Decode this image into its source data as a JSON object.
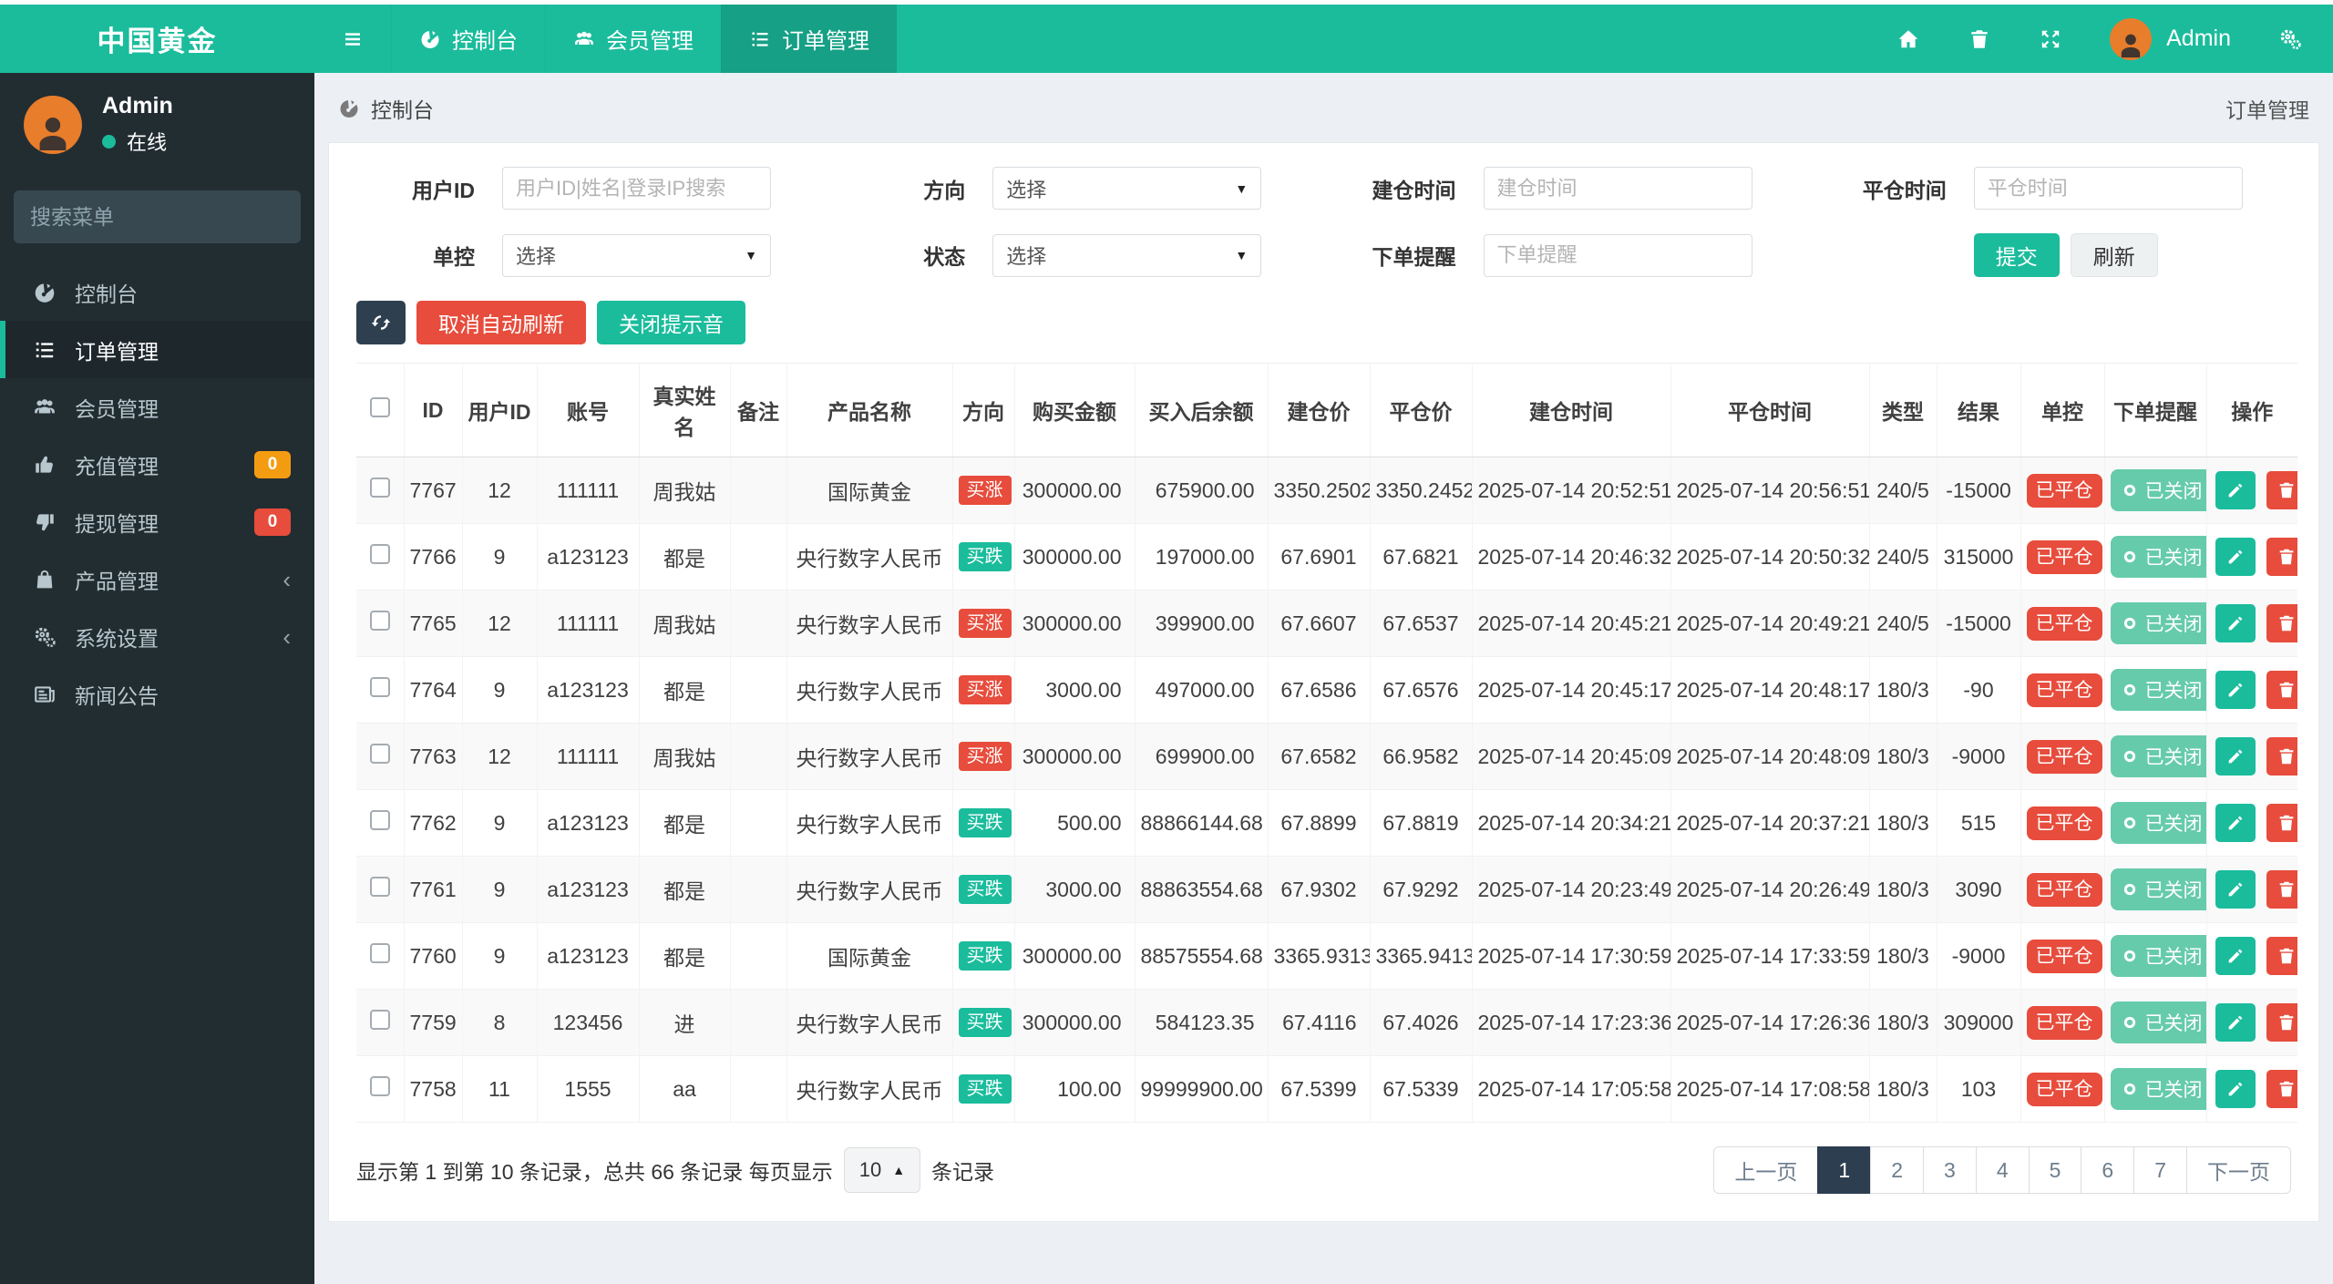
{
  "brand": {
    "title": "中国黄金"
  },
  "navbar": {
    "tabs": [
      {
        "label": "控制台"
      },
      {
        "label": "会员管理"
      },
      {
        "label": "订单管理"
      }
    ],
    "user": "Admin"
  },
  "sidebar": {
    "user": {
      "name": "Admin",
      "status": "在线"
    },
    "search_placeholder": "搜索菜单",
    "items": [
      {
        "label": "控制台"
      },
      {
        "label": "订单管理"
      },
      {
        "label": "会员管理"
      },
      {
        "label": "充值管理",
        "badge": "0",
        "badge_color": "#f39c12"
      },
      {
        "label": "提现管理",
        "badge": "0",
        "badge_color": "#e74c3c"
      },
      {
        "label": "产品管理"
      },
      {
        "label": "系统设置"
      },
      {
        "label": "新闻公告"
      }
    ]
  },
  "breadcrumb": {
    "label": "控制台"
  },
  "page_title": "订单管理",
  "filters": {
    "user_id": {
      "label": "用户ID",
      "placeholder": "用户ID|姓名|登录IP搜索",
      "value": ""
    },
    "direction": {
      "label": "方向",
      "value": "选择"
    },
    "open_time": {
      "label": "建仓时间",
      "placeholder": "建仓时间",
      "value": ""
    },
    "close_time": {
      "label": "平仓时间",
      "placeholder": "平仓时间",
      "value": ""
    },
    "control": {
      "label": "单控",
      "value": "选择"
    },
    "status": {
      "label": "状态",
      "value": "选择"
    },
    "reminder": {
      "label": "下单提醒",
      "placeholder": "下单提醒",
      "value": ""
    },
    "submit": "提交",
    "refresh": "刷新"
  },
  "toolbar": {
    "cancel_auto_refresh": "取消自动刷新",
    "mute": "关闭提示音"
  },
  "table": {
    "headers": [
      "ID",
      "用户ID",
      "账号",
      "真实姓名",
      "备注",
      "产品名称",
      "方向",
      "购买金额",
      "买入后余额",
      "建仓价",
      "平仓价",
      "建仓时间",
      "平仓时间",
      "类型",
      "结果",
      "单控",
      "下单提醒",
      "操作"
    ],
    "direction_colors": {
      "买涨": "#e74c3c",
      "买跌": "#1abc9c"
    },
    "rows": [
      {
        "id": "7767",
        "uid": "12",
        "account": "111111",
        "name": "周我姑",
        "remark": "",
        "product": "国际黄金",
        "dir": "买涨",
        "amount": "300000.00",
        "balance": "675900.00",
        "open_price": "3350.2502",
        "close_price": "3350.2452",
        "open_time": "2025-07-14 20:52:51",
        "close_time": "2025-07-14 20:56:51",
        "type": "240/5",
        "result": "-15000",
        "control": "已平仓",
        "reminder": "已关闭"
      },
      {
        "id": "7766",
        "uid": "9",
        "account": "a123123",
        "name": "都是",
        "remark": "",
        "product": "央行数字人民币",
        "dir": "买跌",
        "amount": "300000.00",
        "balance": "197000.00",
        "open_price": "67.6901",
        "close_price": "67.6821",
        "open_time": "2025-07-14 20:46:32",
        "close_time": "2025-07-14 20:50:32",
        "type": "240/5",
        "result": "315000",
        "control": "已平仓",
        "reminder": "已关闭"
      },
      {
        "id": "7765",
        "uid": "12",
        "account": "111111",
        "name": "周我姑",
        "remark": "",
        "product": "央行数字人民币",
        "dir": "买涨",
        "amount": "300000.00",
        "balance": "399900.00",
        "open_price": "67.6607",
        "close_price": "67.6537",
        "open_time": "2025-07-14 20:45:21",
        "close_time": "2025-07-14 20:49:21",
        "type": "240/5",
        "result": "-15000",
        "control": "已平仓",
        "reminder": "已关闭"
      },
      {
        "id": "7764",
        "uid": "9",
        "account": "a123123",
        "name": "都是",
        "remark": "",
        "product": "央行数字人民币",
        "dir": "买涨",
        "amount": "3000.00",
        "balance": "497000.00",
        "open_price": "67.6586",
        "close_price": "67.6576",
        "open_time": "2025-07-14 20:45:17",
        "close_time": "2025-07-14 20:48:17",
        "type": "180/3",
        "result": "-90",
        "control": "已平仓",
        "reminder": "已关闭"
      },
      {
        "id": "7763",
        "uid": "12",
        "account": "111111",
        "name": "周我姑",
        "remark": "",
        "product": "央行数字人民币",
        "dir": "买涨",
        "amount": "300000.00",
        "balance": "699900.00",
        "open_price": "67.6582",
        "close_price": "66.9582",
        "open_time": "2025-07-14 20:45:09",
        "close_time": "2025-07-14 20:48:09",
        "type": "180/3",
        "result": "-9000",
        "control": "已平仓",
        "reminder": "已关闭"
      },
      {
        "id": "7762",
        "uid": "9",
        "account": "a123123",
        "name": "都是",
        "remark": "",
        "product": "央行数字人民币",
        "dir": "买跌",
        "amount": "500.00",
        "balance": "88866144.68",
        "open_price": "67.8899",
        "close_price": "67.8819",
        "open_time": "2025-07-14 20:34:21",
        "close_time": "2025-07-14 20:37:21",
        "type": "180/3",
        "result": "515",
        "control": "已平仓",
        "reminder": "已关闭"
      },
      {
        "id": "7761",
        "uid": "9",
        "account": "a123123",
        "name": "都是",
        "remark": "",
        "product": "央行数字人民币",
        "dir": "买跌",
        "amount": "3000.00",
        "balance": "88863554.68",
        "open_price": "67.9302",
        "close_price": "67.9292",
        "open_time": "2025-07-14 20:23:49",
        "close_time": "2025-07-14 20:26:49",
        "type": "180/3",
        "result": "3090",
        "control": "已平仓",
        "reminder": "已关闭"
      },
      {
        "id": "7760",
        "uid": "9",
        "account": "a123123",
        "name": "都是",
        "remark": "",
        "product": "国际黄金",
        "dir": "买跌",
        "amount": "300000.00",
        "balance": "88575554.68",
        "open_price": "3365.9313",
        "close_price": "3365.9413",
        "open_time": "2025-07-14 17:30:59",
        "close_time": "2025-07-14 17:33:59",
        "type": "180/3",
        "result": "-9000",
        "control": "已平仓",
        "reminder": "已关闭"
      },
      {
        "id": "7759",
        "uid": "8",
        "account": "123456",
        "name": "进",
        "remark": "",
        "product": "央行数字人民币",
        "dir": "买跌",
        "amount": "300000.00",
        "balance": "584123.35",
        "open_price": "67.4116",
        "close_price": "67.4026",
        "open_time": "2025-07-14 17:23:36",
        "close_time": "2025-07-14 17:26:36",
        "type": "180/3",
        "result": "309000",
        "control": "已平仓",
        "reminder": "已关闭"
      },
      {
        "id": "7758",
        "uid": "11",
        "account": "1555",
        "name": "aa",
        "remark": "",
        "product": "央行数字人民币",
        "dir": "买跌",
        "amount": "100.00",
        "balance": "99999900.00",
        "open_price": "67.5399",
        "close_price": "67.5339",
        "open_time": "2025-07-14 17:05:58",
        "close_time": "2025-07-14 17:08:58",
        "type": "180/3",
        "result": "103",
        "control": "已平仓",
        "reminder": "已关闭"
      }
    ]
  },
  "footer": {
    "info_prefix": "显示第 1 到第 10 条记录，总共 66 条记录 每页显示",
    "page_size": "10",
    "info_suffix": "条记录",
    "pagination": {
      "prev": "上一页",
      "pages": [
        "1",
        "2",
        "3",
        "4",
        "5",
        "6",
        "7"
      ],
      "active": "1",
      "next": "下一页"
    }
  },
  "colors": {
    "navbar": "#1abc9c",
    "navbar_active": "#16a085",
    "sidebar": "#222d32",
    "danger": "#e74c3c",
    "success": "#1abc9c",
    "dark": "#2c3e50"
  }
}
